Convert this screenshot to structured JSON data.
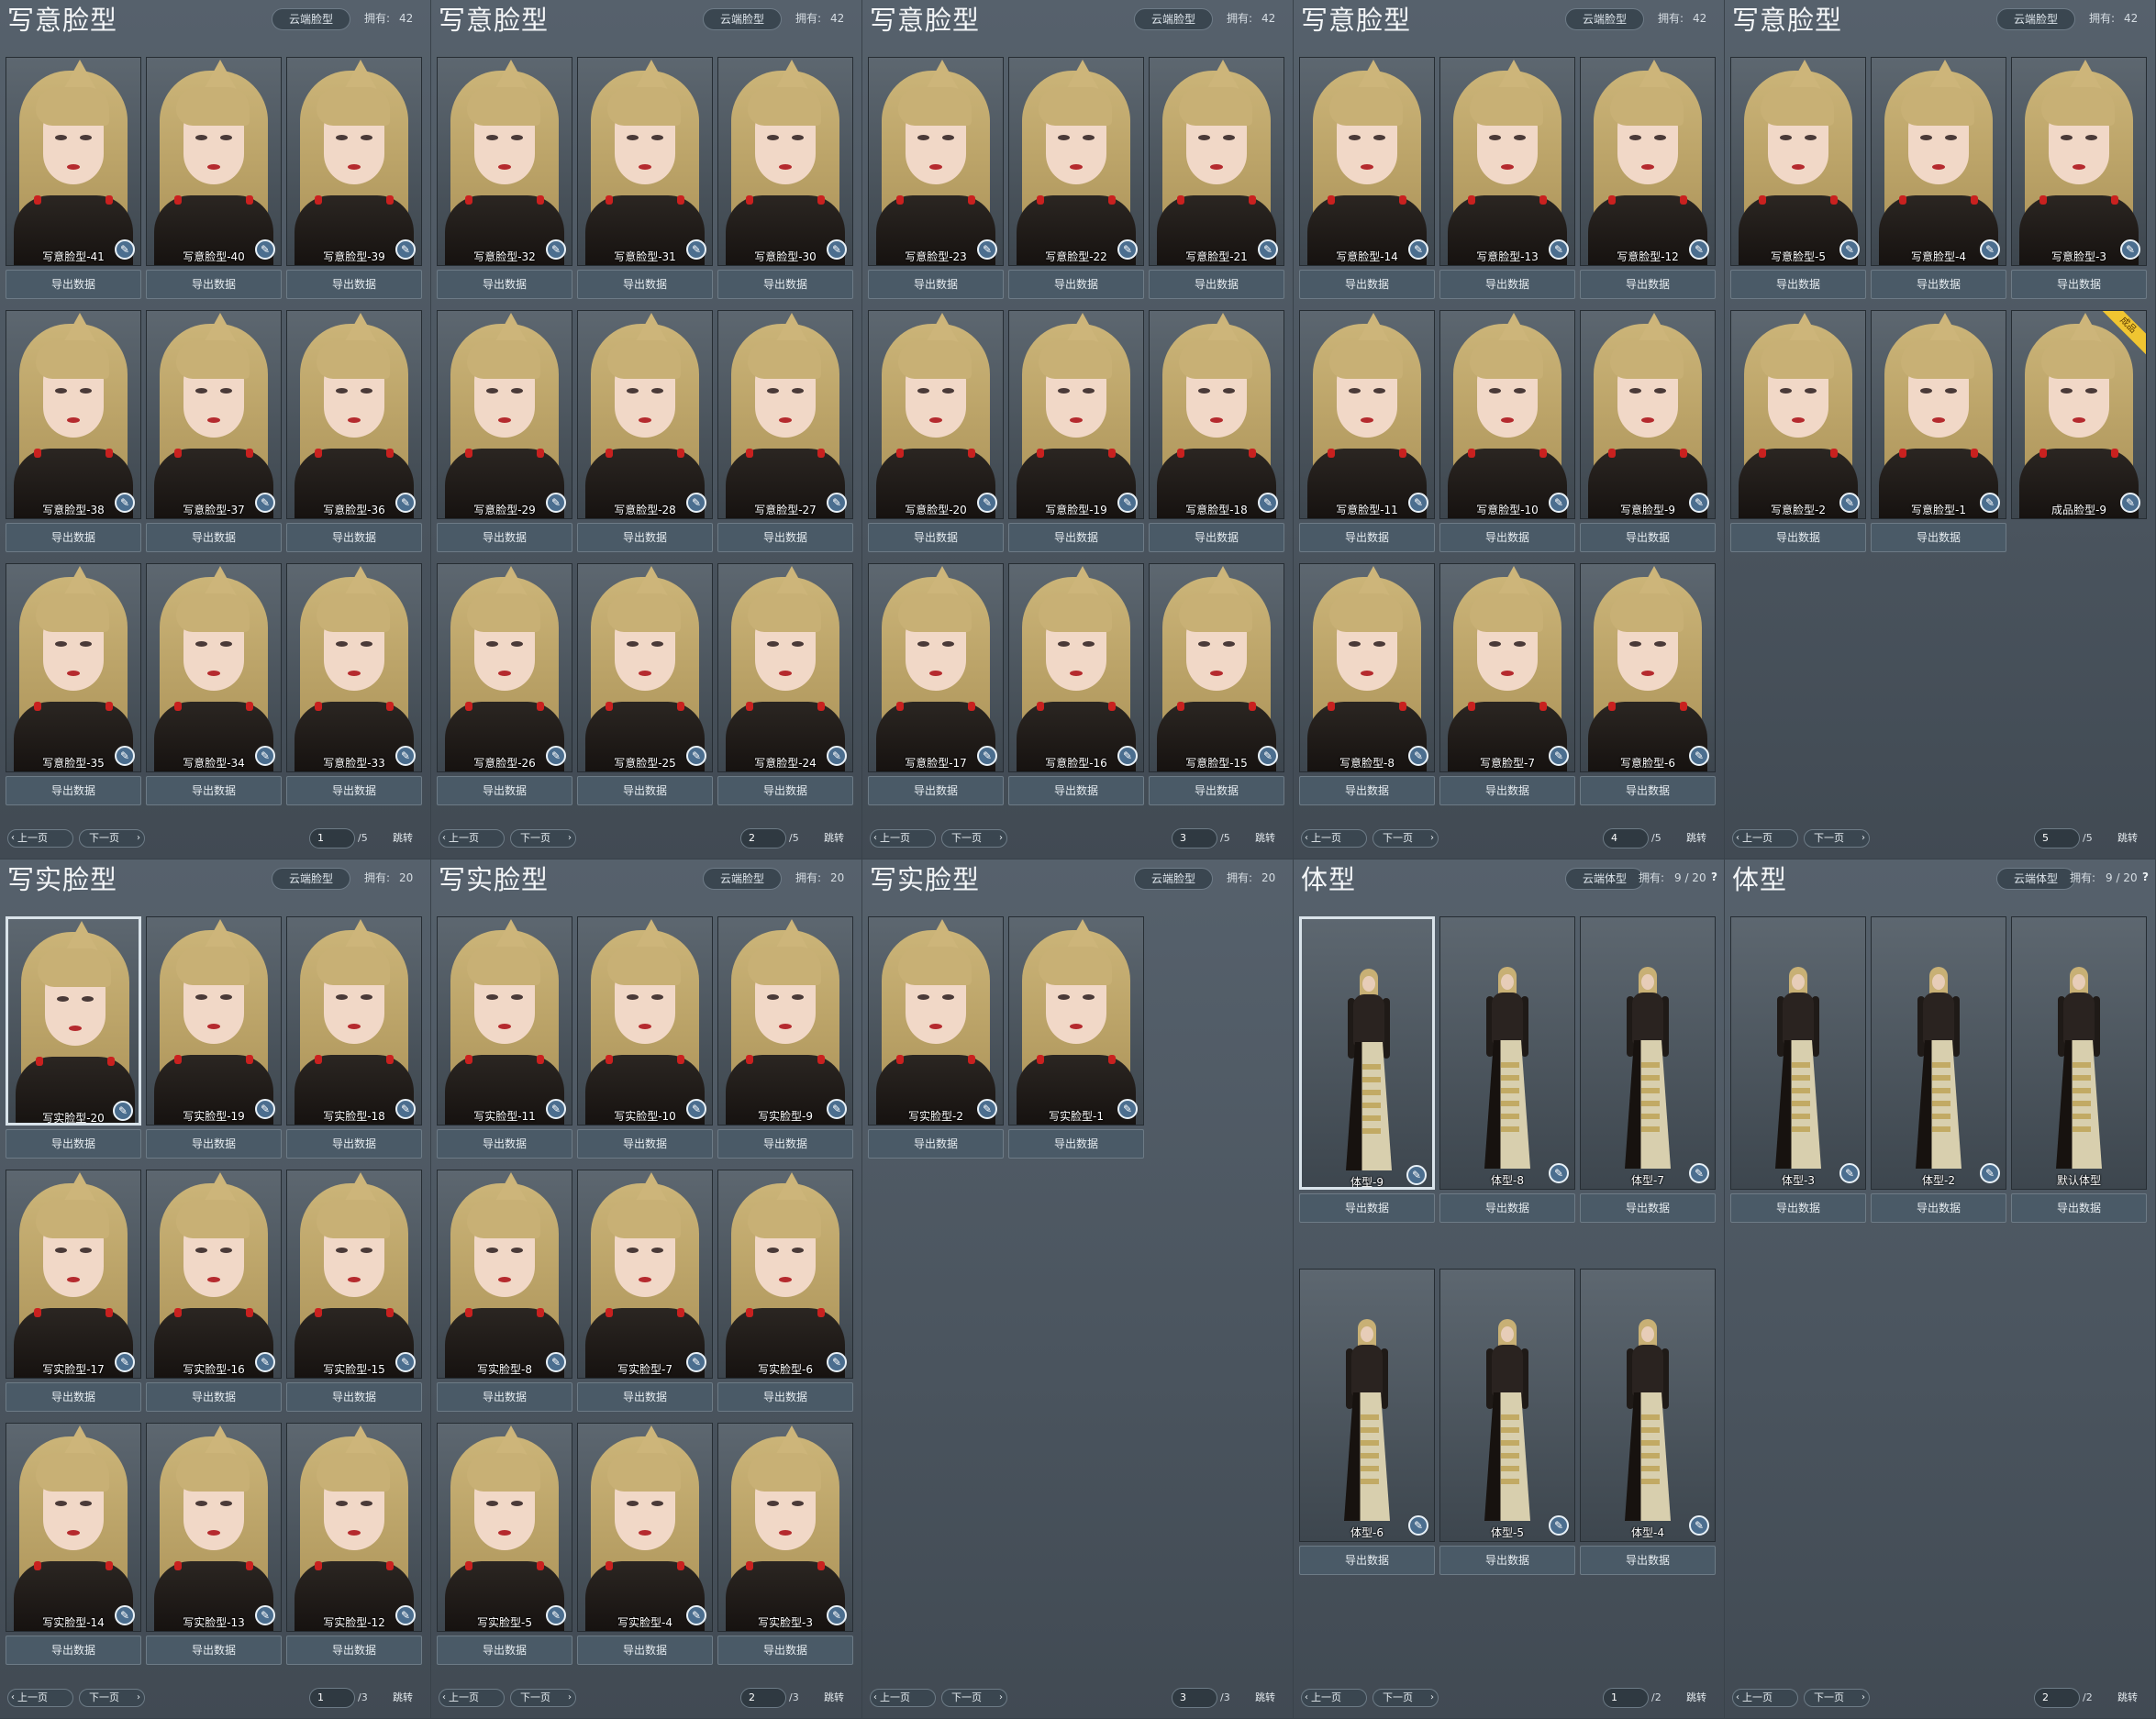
{
  "labels": {
    "export": "导出数据",
    "prev": "上一页",
    "next": "下一页",
    "jump": "跳转",
    "owned": "拥有:",
    "help": "?",
    "edit_glyph": "✎",
    "prev_glyph": "‹",
    "next_glyph": "›",
    "ribbon_text": "成品"
  },
  "colors": {
    "panel_bg": "#4a545e",
    "button_bg": "#4a5a67",
    "badge_blue": "#4b6e8f",
    "ribbon_gold": "#f0c531"
  },
  "panels": [
    {
      "title": "写意脸型",
      "cloud": "云端脸型",
      "owned": "42",
      "page": "1",
      "total": "/5",
      "type": "face",
      "help": false,
      "items": [
        "写意脸型-41",
        "写意脸型-40",
        "写意脸型-39",
        "写意脸型-38",
        "写意脸型-37",
        "写意脸型-36",
        "写意脸型-35",
        "写意脸型-34",
        "写意脸型-33"
      ]
    },
    {
      "title": "写意脸型",
      "cloud": "云端脸型",
      "owned": "42",
      "page": "2",
      "total": "/5",
      "type": "face",
      "help": false,
      "items": [
        "写意脸型-32",
        "写意脸型-31",
        "写意脸型-30",
        "写意脸型-29",
        "写意脸型-28",
        "写意脸型-27",
        "写意脸型-26",
        "写意脸型-25",
        "写意脸型-24"
      ]
    },
    {
      "title": "写意脸型",
      "cloud": "云端脸型",
      "owned": "42",
      "page": "3",
      "total": "/5",
      "type": "face",
      "help": false,
      "items": [
        "写意脸型-23",
        "写意脸型-22",
        "写意脸型-21",
        "写意脸型-20",
        "写意脸型-19",
        "写意脸型-18",
        "写意脸型-17",
        "写意脸型-16",
        "写意脸型-15"
      ]
    },
    {
      "title": "写意脸型",
      "cloud": "云端脸型",
      "owned": "42",
      "page": "4",
      "total": "/5",
      "type": "face",
      "help": false,
      "items": [
        "写意脸型-14",
        "写意脸型-13",
        "写意脸型-12",
        "写意脸型-11",
        "写意脸型-10",
        "写意脸型-9",
        "写意脸型-8",
        "写意脸型-7",
        "写意脸型-6"
      ]
    },
    {
      "title": "写意脸型",
      "cloud": "云端脸型",
      "owned": "42",
      "page": "5",
      "total": "/5",
      "type": "face",
      "help": false,
      "items": [
        "写意脸型-5",
        "写意脸型-4",
        "写意脸型-3",
        "写意脸型-2",
        "写意脸型-1",
        "成品脸型-9"
      ],
      "ribbon_index": 5,
      "no_export_index": 5
    },
    {
      "title": "写实脸型",
      "cloud": "云端脸型",
      "owned": "20",
      "page": "1",
      "total": "/3",
      "type": "face",
      "help": false,
      "selected_index": 0,
      "items": [
        "写实脸型-20",
        "写实脸型-19",
        "写实脸型-18",
        "写实脸型-17",
        "写实脸型-16",
        "写实脸型-15",
        "写实脸型-14",
        "写实脸型-13",
        "写实脸型-12"
      ]
    },
    {
      "title": "写实脸型",
      "cloud": "云端脸型",
      "owned": "20",
      "page": "2",
      "total": "/3",
      "type": "face",
      "help": false,
      "items": [
        "写实脸型-11",
        "写实脸型-10",
        "写实脸型-9",
        "写实脸型-8",
        "写实脸型-7",
        "写实脸型-6",
        "写实脸型-5",
        "写实脸型-4",
        "写实脸型-3"
      ]
    },
    {
      "title": "写实脸型",
      "cloud": "云端脸型",
      "owned": "20",
      "page": "3",
      "total": "/3",
      "type": "face",
      "help": false,
      "items": [
        "写实脸型-2",
        "写实脸型-1"
      ]
    },
    {
      "title": "体型",
      "cloud": "云端体型",
      "owned": "9 / 20",
      "page": "1",
      "total": "/2",
      "type": "body",
      "help": true,
      "selected_index": 0,
      "items": [
        "体型-9",
        "体型-8",
        "体型-7",
        "体型-6",
        "体型-5",
        "体型-4"
      ]
    },
    {
      "title": "体型",
      "cloud": "云端体型",
      "owned": "9 / 20",
      "page": "2",
      "total": "/2",
      "type": "body",
      "help": true,
      "no_badge_index": 2,
      "items": [
        "体型-3",
        "体型-2",
        "默认体型"
      ]
    }
  ]
}
